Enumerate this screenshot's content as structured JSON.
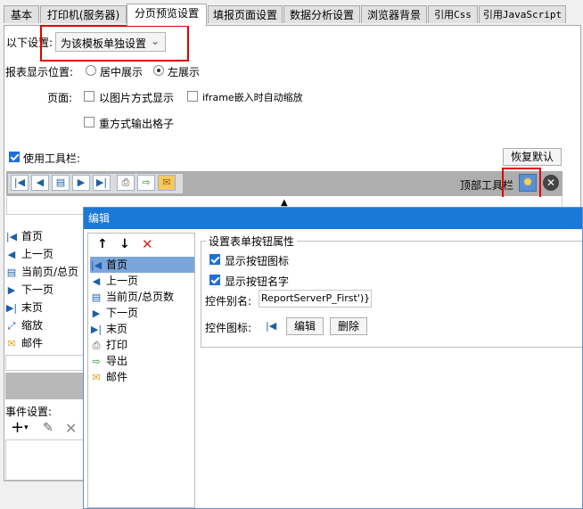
{
  "tabs": [
    {
      "label": "基本"
    },
    {
      "label": "打印机(服务器)"
    },
    {
      "label": "分页预览设置"
    },
    {
      "label": "填报页面设置"
    },
    {
      "label": "数据分析设置"
    },
    {
      "label": "浏览器背景"
    },
    {
      "label": "引用Css"
    },
    {
      "label": "引用JavaScript"
    }
  ],
  "settings": {
    "mode_label": "以下设置:",
    "mode_value": "为该模板单独设置",
    "position_label": "报表显示位置:",
    "position_center": "居中展示",
    "position_left": "左展示",
    "page_label": "页面:",
    "page_image": "以图片方式显示",
    "page_iframe": "iframe嵌入时自动缩放",
    "page_repeat": "重方式输出格子"
  },
  "toolbar": {
    "use_label": "使用工具栏:",
    "restore_label": "恢复默认",
    "top_label": "顶部工具栏"
  },
  "left_list": [
    {
      "label": "首页",
      "icon": "first-page-icon",
      "glyph": "|◀"
    },
    {
      "label": "上一页",
      "icon": "prev-page-icon",
      "glyph": "◀"
    },
    {
      "label": "当前页/总页",
      "icon": "page-count-icon",
      "glyph": "▤"
    },
    {
      "label": "下一页",
      "icon": "next-page-icon",
      "glyph": "▶"
    },
    {
      "label": "末页",
      "icon": "last-page-icon",
      "glyph": "▶|"
    },
    {
      "label": "缩放",
      "icon": "zoom-icon",
      "glyph": "⤢"
    },
    {
      "label": "邮件",
      "icon": "mail-icon",
      "glyph": "✉"
    }
  ],
  "events": {
    "label": "事件设置:"
  },
  "dialog": {
    "title": "编辑",
    "items": [
      {
        "label": "首页",
        "icon": "first-page-icon",
        "glyph": "|◀"
      },
      {
        "label": "上一页",
        "icon": "prev-page-icon",
        "glyph": "◀"
      },
      {
        "label": "当前页/总页数",
        "icon": "page-count-icon",
        "glyph": "▤"
      },
      {
        "label": "下一页",
        "icon": "next-page-icon",
        "glyph": "▶"
      },
      {
        "label": "末页",
        "icon": "last-page-icon",
        "glyph": "▶|"
      },
      {
        "label": "打印",
        "icon": "print-icon",
        "glyph": "⎙"
      },
      {
        "label": "导出",
        "icon": "export-icon",
        "glyph": "⇨"
      },
      {
        "label": "邮件",
        "icon": "mail-icon",
        "glyph": "✉"
      }
    ],
    "props": {
      "group_title": "设置表单按钮属性",
      "show_icon": "显示按钮图标",
      "show_name": "显示按钮名字",
      "alias_label": "控件别名:",
      "alias_value": "ReportServerP_First')}",
      "icon_label": "控件图标:",
      "edit_label": "编辑",
      "delete_label": "删除"
    }
  }
}
